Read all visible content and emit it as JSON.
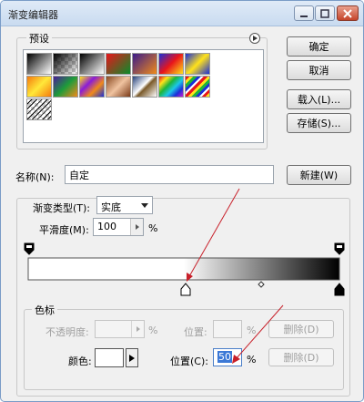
{
  "window": {
    "title": "渐变编辑器"
  },
  "presets": {
    "label": "预设",
    "swatches": [
      {
        "name": "foreground-to-background",
        "bg": "linear-gradient(135deg,#000 0%,#ffffff 100%)"
      },
      {
        "name": "foreground-to-transparent",
        "bg": "linear-gradient(135deg,#000 0%,rgba(0,0,0,0) 100%),repeating-conic-gradient(#ccc 0 25%,#fff 0 50%) 0 0/8px 8px"
      },
      {
        "name": "black-white",
        "bg": "linear-gradient(135deg,#000 0%,#fff 100%)"
      },
      {
        "name": "red-green",
        "bg": "linear-gradient(135deg,#e8151b 0%,#0a8c2a 100%)"
      },
      {
        "name": "violet-orange",
        "bg": "linear-gradient(135deg,#3a1b8a 0%,#f08a1a 100%)"
      },
      {
        "name": "blue-red-yellow",
        "bg": "linear-gradient(135deg,#1b2fd8 0%,#e8151b 50%,#ffe21a 100%)"
      },
      {
        "name": "blue-yellow-blue",
        "bg": "linear-gradient(135deg,#1b2fd8 0%,#ffe21a 50%,#1b2fd8 100%)"
      },
      {
        "name": "orange-yellow-orange",
        "bg": "linear-gradient(135deg,#f57a0c 0%,#ffe83a 50%,#f57a0c 100%)"
      },
      {
        "name": "violet-green-orange",
        "bg": "linear-gradient(135deg,#4a1b9a 0%,#1d9c3a 50%,#f08a1a 100%)"
      },
      {
        "name": "yellow-violet-orange-blue",
        "bg": "linear-gradient(135deg,#ffe21a 0%,#8a1bd8 35%,#f08a1a 65%,#1b2fd8 100%)"
      },
      {
        "name": "copper",
        "bg": "linear-gradient(135deg,#8a4a22 0%,#f0c3a0 50%,#7a3a18 100%)"
      },
      {
        "name": "chrome",
        "bg": "linear-gradient(135deg,#25407a 0%,#ffffff 45%,#7a5a2a 55%,#fff 100%)"
      },
      {
        "name": "spectrum",
        "bg": "linear-gradient(135deg,#e8151b,#ffe21a,#1db53a,#1bc8e8,#1b2fd8,#c81bd8)"
      },
      {
        "name": "transparent-rainbow",
        "bg": "repeating-linear-gradient(135deg,#e8151b 0 3px,#ffe21a 3px 6px,#1db53a 6px 9px,#1b2fd8 9px 12px,#fff 12px 14px)"
      },
      {
        "name": "transparent-stripes",
        "bg": "repeating-linear-gradient(135deg,rgba(0,0,0,0) 0 3px,#000 3px 4px),repeating-conic-gradient(#ccc 0 25%,#fff 0 50%) 0 0/8px 8px"
      }
    ]
  },
  "buttons": {
    "ok": "确定",
    "cancel": "取消",
    "load": "载入(L)...",
    "save": "存储(S)...",
    "new": "新建(W)"
  },
  "name": {
    "label": "名称(N):",
    "value": "自定"
  },
  "gradient": {
    "group_label": "",
    "type_label": "渐变类型(T):",
    "type_value": "实底",
    "smoothness_label": "平滑度(M):",
    "smoothness_value": "100",
    "smoothness_unit": "%"
  },
  "stops": {
    "label": "色标",
    "opacity_label": "不透明度:",
    "opacity_unit": "%",
    "location_label_disabled": "位置:",
    "location_unit_disabled": "%",
    "delete_label_disabled": "删除(D)",
    "color_label": "颜色:",
    "location_label": "位置(C):",
    "location_value": "50",
    "location_unit": "%",
    "delete_label": "删除(D)",
    "selected_color": "#ffffff"
  },
  "colors": {
    "accent": "#cfe1f7",
    "arrow": "#c8202a"
  }
}
